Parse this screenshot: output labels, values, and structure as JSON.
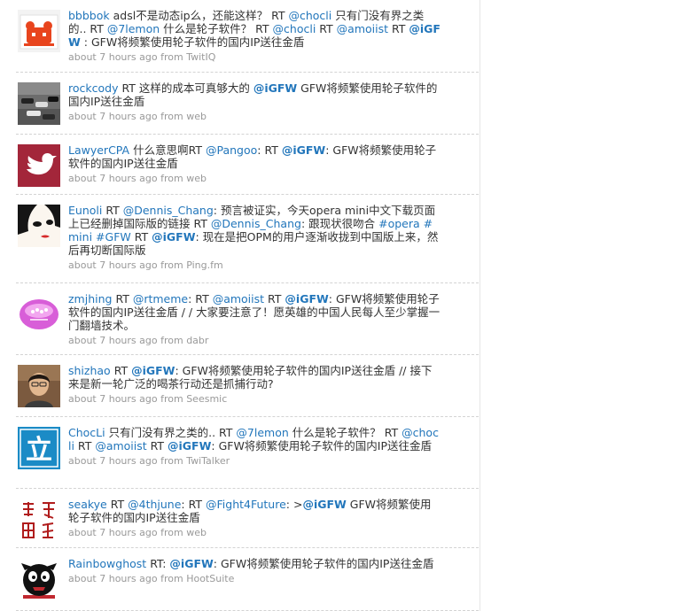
{
  "tweets": [
    {
      "user": "bbbbok",
      "avatar_icon": "bear-face-avatar",
      "parts": [
        {
          "t": "adsl不是动态ip么，还能这样？ RT "
        },
        {
          "t": "@chocli",
          "link": true
        },
        {
          "t": " 只有门没有界之类的.. RT "
        },
        {
          "t": "@7lemon",
          "link": true
        },
        {
          "t": " 什么是轮子软件？ RT "
        },
        {
          "t": "@chocli",
          "link": true
        },
        {
          "t": " RT "
        },
        {
          "t": "@amoiist",
          "link": true
        },
        {
          "t": " RT "
        },
        {
          "t": "@iGFW",
          "link": true,
          "bold": true
        },
        {
          "t": " : GFW将频繁使用轮子软件的国内IP送往金盾"
        }
      ],
      "time": "about 7 hours ago",
      "from_label": " from ",
      "source": "TwitIQ"
    },
    {
      "user": "rockcody",
      "avatar_icon": "race-cars-avatar",
      "parts": [
        {
          "t": " RT 这样的成本可真够大的 "
        },
        {
          "t": "@iGFW",
          "link": true,
          "bold": true
        },
        {
          "t": " GFW将频繁使用轮子软件的国内IP送往金盾"
        }
      ],
      "time": "about 7 hours ago",
      "from_label": " from ",
      "source": "web"
    },
    {
      "user": "LawyerCPA",
      "avatar_icon": "bird-avatar",
      "parts": [
        {
          "t": " 什么意思啊RT "
        },
        {
          "t": "@Pangoo",
          "link": true
        },
        {
          "t": ": RT "
        },
        {
          "t": "@iGFW",
          "link": true,
          "bold": true
        },
        {
          "t": ": GFW将频繁使用轮子软件的国内IP送往金盾"
        }
      ],
      "time": "about 7 hours ago",
      "from_label": " from ",
      "source": "web"
    },
    {
      "user": "Eunoli",
      "avatar_icon": "cartoon-face-avatar",
      "parts": [
        {
          "t": " RT "
        },
        {
          "t": "@Dennis_Chang",
          "link": true
        },
        {
          "t": ": 预言被证实，今天opera mini中文下载页面上已经删掉国际版的链接 RT "
        },
        {
          "t": "@Dennis_Chang",
          "link": true
        },
        {
          "t": ": 跟现状很吻合 "
        },
        {
          "t": "#opera",
          "link": true
        },
        {
          "t": " "
        },
        {
          "t": "#mini",
          "link": true
        },
        {
          "t": " "
        },
        {
          "t": "#GFW",
          "link": true
        },
        {
          "t": " RT "
        },
        {
          "t": "@iGFW",
          "link": true,
          "bold": true
        },
        {
          "t": ": 现在是把OPM的用户逐渐收拢到中国版上来，然后再切断国际版"
        }
      ],
      "time": "about 7 hours ago",
      "from_label": " from ",
      "source": "Ping.fm"
    },
    {
      "user": "zmjhing",
      "avatar_icon": "pink-logo-avatar",
      "parts": [
        {
          "t": " RT "
        },
        {
          "t": "@rtmeme",
          "link": true
        },
        {
          "t": ": RT "
        },
        {
          "t": "@amoiist",
          "link": true
        },
        {
          "t": " RT "
        },
        {
          "t": "@iGFW",
          "link": true,
          "bold": true
        },
        {
          "t": ": GFW将频繁使用轮子软件的国内IP送往金盾 / / 大家要注意了！愿英雄的中国人民每人至少掌握一门翻墙技术。"
        }
      ],
      "time": "about 7 hours ago",
      "from_label": " from ",
      "source": "dabr"
    },
    {
      "user": "shizhao",
      "avatar_icon": "person-photo-avatar",
      "parts": [
        {
          "t": " RT "
        },
        {
          "t": "@iGFW",
          "link": true,
          "bold": true
        },
        {
          "t": ": GFW将频繁使用轮子软件的国内IP送往金盾 // 接下来是新一轮广泛的喝茶行动还是抓捕行动?"
        }
      ],
      "time": "about 7 hours ago",
      "from_label": " from ",
      "source": "Seesmic"
    },
    {
      "user": "ChocLi",
      "avatar_icon": "li-character-avatar",
      "avatar_glyph": "立",
      "parts": [
        {
          "t": " 只有门没有界之类的.. RT "
        },
        {
          "t": "@7lemon",
          "link": true
        },
        {
          "t": " 什么是轮子软件？ RT "
        },
        {
          "t": "@chocli",
          "link": true
        },
        {
          "t": " RT "
        },
        {
          "t": "@amoiist",
          "link": true
        },
        {
          "t": " RT "
        },
        {
          "t": "@iGFW",
          "link": true,
          "bold": true
        },
        {
          "t": ": GFW将频繁使用轮子软件的国内IP送往金盾"
        }
      ],
      "time": "about 7 hours ago",
      "from_label": " from ",
      "source": "TwiTalker"
    },
    {
      "user": "seakye",
      "avatar_icon": "seal-script-avatar",
      "parts": [
        {
          "t": " RT "
        },
        {
          "t": "@4thjune",
          "link": true
        },
        {
          "t": ": RT "
        },
        {
          "t": "@Fight4Future",
          "link": true
        },
        {
          "t": ": >"
        },
        {
          "t": "@iGFW",
          "link": true,
          "bold": true
        },
        {
          "t": " GFW将频繁使用轮子软件的国内IP送往金盾"
        }
      ],
      "time": "about 7 hours ago",
      "from_label": " from ",
      "source": "web"
    },
    {
      "user": "Rainbowghost",
      "avatar_icon": "black-ghost-avatar",
      "parts": [
        {
          "t": " RT: "
        },
        {
          "t": "@iGFW",
          "link": true,
          "bold": true
        },
        {
          "t": ": GFW将频繁使用轮子软件的国内IP送往金盾"
        }
      ],
      "time": "about 7 hours ago",
      "from_label": " from ",
      "source": "HootSuite"
    }
  ]
}
